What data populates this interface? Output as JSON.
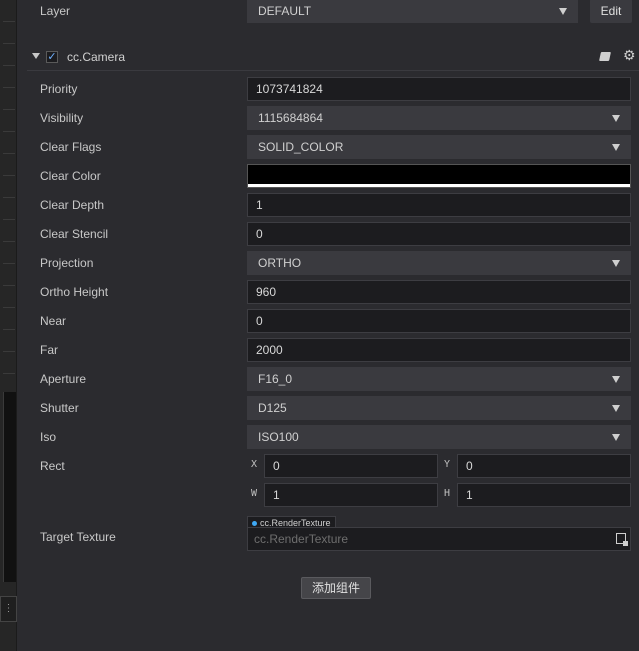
{
  "layer": {
    "label": "Layer",
    "value": "DEFAULT",
    "edit_label": "Edit"
  },
  "component": {
    "title": "cc.Camera",
    "enabled": true
  },
  "props": {
    "priority": {
      "label": "Priority",
      "value": "1073741824"
    },
    "visibility": {
      "label": "Visibility",
      "value": "1115684864"
    },
    "clear_flags": {
      "label": "Clear Flags",
      "value": "SOLID_COLOR"
    },
    "clear_color": {
      "label": "Clear Color",
      "color": "#000000"
    },
    "clear_depth": {
      "label": "Clear Depth",
      "value": "1"
    },
    "clear_stencil": {
      "label": "Clear Stencil",
      "value": "0"
    },
    "projection": {
      "label": "Projection",
      "value": "ORTHO"
    },
    "ortho_height": {
      "label": "Ortho Height",
      "value": "960"
    },
    "near": {
      "label": "Near",
      "value": "0"
    },
    "far": {
      "label": "Far",
      "value": "2000"
    },
    "aperture": {
      "label": "Aperture",
      "value": "F16_0"
    },
    "shutter": {
      "label": "Shutter",
      "value": "D125"
    },
    "iso": {
      "label": "Iso",
      "value": "ISO100"
    },
    "rect": {
      "label": "Rect",
      "x_label": "X",
      "x": "0",
      "y_label": "Y",
      "y": "0",
      "w_label": "W",
      "w": "1",
      "h_label": "H",
      "h": "1"
    },
    "target_texture": {
      "label": "Target Texture",
      "type_tag": "cc.RenderTexture",
      "placeholder": "cc.RenderTexture"
    }
  },
  "add_component_label": "添加组件",
  "icons": {
    "book": "book-icon",
    "gear": "gear-icon",
    "checkbox": "checkbox-checked",
    "collapse": "triangle-down-icon",
    "dropdown": "caret-down-icon",
    "picker": "asset-picker-icon"
  },
  "colors": {
    "panel_bg": "#2b2b2f",
    "field_bg": "#1c1c1f",
    "select_bg": "#3a3a3f",
    "accent": "#3fa9f5"
  }
}
